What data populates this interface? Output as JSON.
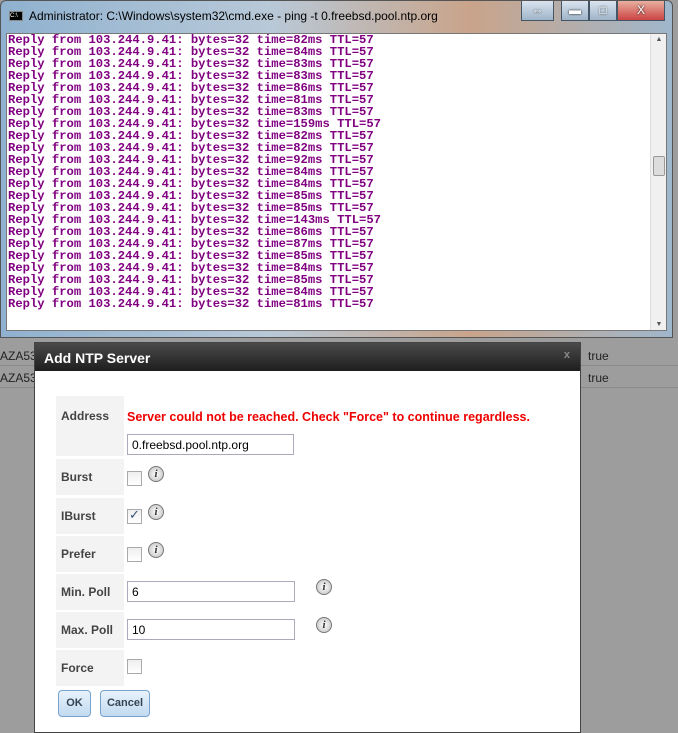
{
  "window": {
    "title": "Administrator: C:\\Windows\\system32\\cmd.exe - ping  -t 0.freebsd.pool.ntp.org",
    "restore": "⇔",
    "minimize": "▬",
    "maximize": "□",
    "close": "X"
  },
  "console_lines": [
    "Reply from 103.244.9.41: bytes=32 time=82ms TTL=57",
    "Reply from 103.244.9.41: bytes=32 time=84ms TTL=57",
    "Reply from 103.244.9.41: bytes=32 time=83ms TTL=57",
    "Reply from 103.244.9.41: bytes=32 time=83ms TTL=57",
    "Reply from 103.244.9.41: bytes=32 time=86ms TTL=57",
    "Reply from 103.244.9.41: bytes=32 time=81ms TTL=57",
    "Reply from 103.244.9.41: bytes=32 time=83ms TTL=57",
    "Reply from 103.244.9.41: bytes=32 time=159ms TTL=57",
    "Reply from 103.244.9.41: bytes=32 time=82ms TTL=57",
    "Reply from 103.244.9.41: bytes=32 time=82ms TTL=57",
    "Reply from 103.244.9.41: bytes=32 time=92ms TTL=57",
    "Reply from 103.244.9.41: bytes=32 time=84ms TTL=57",
    "Reply from 103.244.9.41: bytes=32 time=84ms TTL=57",
    "Reply from 103.244.9.41: bytes=32 time=85ms TTL=57",
    "Reply from 103.244.9.41: bytes=32 time=85ms TTL=57",
    "Reply from 103.244.9.41: bytes=32 time=143ms TTL=57",
    "Reply from 103.244.9.41: bytes=32 time=86ms TTL=57",
    "Reply from 103.244.9.41: bytes=32 time=87ms TTL=57",
    "Reply from 103.244.9.41: bytes=32 time=85ms TTL=57",
    "Reply from 103.244.9.41: bytes=32 time=84ms TTL=57",
    "Reply from 103.244.9.41: bytes=32 time=85ms TTL=57",
    "Reply from 103.244.9.41: bytes=32 time=84ms TTL=57",
    "Reply from 103.244.9.41: bytes=32 time=81ms TTL=57"
  ],
  "background_rows": [
    {
      "left": "AZA53",
      "right": "true"
    },
    {
      "left": "AZA53",
      "right": "true"
    }
  ],
  "dialog": {
    "title": "Add NTP Server",
    "close": "x",
    "address_label": "Address",
    "error": "Server could not be reached. Check \"Force\" to continue regardless.",
    "address_value": "0.freebsd.pool.ntp.org",
    "burst_label": "Burst",
    "burst_checked": false,
    "iburst_label": "IBurst",
    "iburst_checked": true,
    "prefer_label": "Prefer",
    "prefer_checked": false,
    "minpoll_label": "Min. Poll",
    "minpoll_value": "6",
    "maxpoll_label": "Max. Poll",
    "maxpoll_value": "10",
    "force_label": "Force",
    "force_checked": false,
    "info": "i",
    "ok": "OK",
    "cancel": "Cancel"
  }
}
